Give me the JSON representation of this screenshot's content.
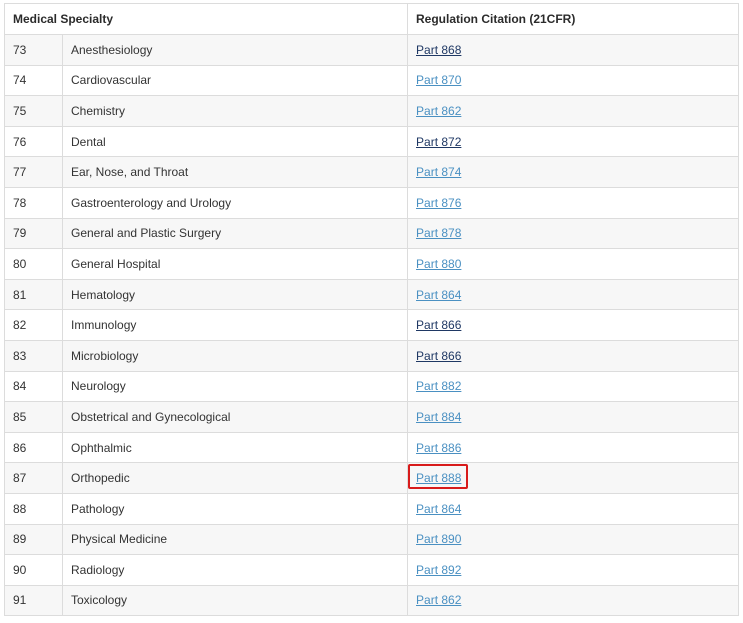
{
  "table": {
    "headers": {
      "number": "",
      "specialty": "Medical Specialty",
      "citation": "Regulation Citation (21CFR)"
    },
    "rows": [
      {
        "num": "73",
        "specialty": "Anesthesiology",
        "citation": "Part 868",
        "visited": true,
        "highlighted": false
      },
      {
        "num": "74",
        "specialty": "Cardiovascular",
        "citation": "Part 870",
        "visited": false,
        "highlighted": false
      },
      {
        "num": "75",
        "specialty": "Chemistry",
        "citation": "Part 862",
        "visited": false,
        "highlighted": false
      },
      {
        "num": "76",
        "specialty": "Dental",
        "citation": "Part 872",
        "visited": true,
        "highlighted": false
      },
      {
        "num": "77",
        "specialty": "Ear, Nose, and Throat",
        "citation": "Part 874",
        "visited": false,
        "highlighted": false
      },
      {
        "num": "78",
        "specialty": "Gastroenterology and Urology",
        "citation": "Part 876",
        "visited": false,
        "highlighted": false
      },
      {
        "num": "79",
        "specialty": "General and Plastic Surgery",
        "citation": "Part 878",
        "visited": false,
        "highlighted": false
      },
      {
        "num": "80",
        "specialty": "General Hospital",
        "citation": "Part 880",
        "visited": false,
        "highlighted": false
      },
      {
        "num": "81",
        "specialty": "Hematology",
        "citation": "Part 864",
        "visited": false,
        "highlighted": false
      },
      {
        "num": "82",
        "specialty": "Immunology",
        "citation": "Part 866",
        "visited": true,
        "highlighted": false
      },
      {
        "num": "83",
        "specialty": "Microbiology",
        "citation": "Part 866",
        "visited": true,
        "highlighted": false
      },
      {
        "num": "84",
        "specialty": "Neurology",
        "citation": "Part 882",
        "visited": false,
        "highlighted": false
      },
      {
        "num": "85",
        "specialty": "Obstetrical and Gynecological",
        "citation": "Part 884",
        "visited": false,
        "highlighted": false
      },
      {
        "num": "86",
        "specialty": "Ophthalmic",
        "citation": "Part 886",
        "visited": false,
        "highlighted": false
      },
      {
        "num": "87",
        "specialty": "Orthopedic",
        "citation": "Part 888",
        "visited": false,
        "highlighted": true
      },
      {
        "num": "88",
        "specialty": "Pathology",
        "citation": "Part 864",
        "visited": false,
        "highlighted": false
      },
      {
        "num": "89",
        "specialty": "Physical Medicine",
        "citation": "Part 890",
        "visited": false,
        "highlighted": false
      },
      {
        "num": "90",
        "specialty": "Radiology",
        "citation": "Part 892",
        "visited": false,
        "highlighted": false
      },
      {
        "num": "91",
        "specialty": "Toxicology",
        "citation": "Part 862",
        "visited": false,
        "highlighted": false
      }
    ]
  },
  "colors": {
    "link": "#4a90c2",
    "link_visited": "#1f3864",
    "highlight_border": "#d81b1b",
    "row_stripe": "#f7f7f7",
    "border": "#dcdcdc"
  }
}
